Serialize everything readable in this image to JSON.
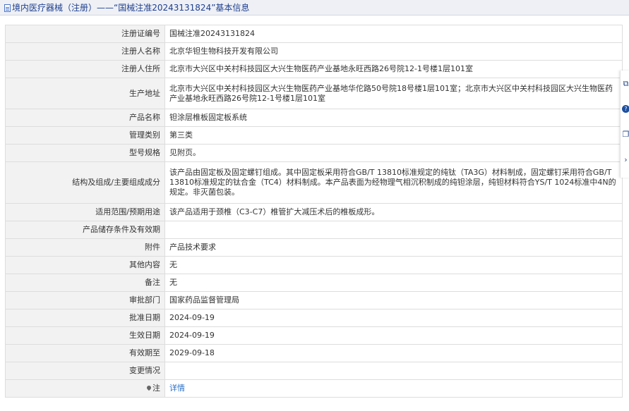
{
  "header": {
    "title": "境内医疗器械（注册）——“国械注准20243131824”基本信息"
  },
  "rows": [
    {
      "label": "注册证编号",
      "value": "国械注准20243131824"
    },
    {
      "label": "注册人名称",
      "value": "北京华钽生物科技开发有限公司"
    },
    {
      "label": "注册人住所",
      "value": "北京市大兴区中关村科技园区大兴生物医药产业基地永旺西路26号院12-1号楼1层101室"
    },
    {
      "label": "生产地址",
      "value": "北京市大兴区中关村科技园区大兴生物医药产业基地华佗路50号院18号楼1层101室；北京市大兴区中关村科技园区大兴生物医药产业基地永旺西路26号院12-1号楼1层101室"
    },
    {
      "label": "产品名称",
      "value": "钽涂层椎板固定板系统"
    },
    {
      "label": "管理类别",
      "value": "第三类"
    },
    {
      "label": "型号规格",
      "value": "见附页。"
    },
    {
      "label": "结构及组成/主要组成成分",
      "value": "该产品由固定板及固定螺钉组成。其中固定板采用符合GB/T 13810标准规定的纯钛（TA3G）材料制成，固定螺钉采用符合GB/T 13810标准规定的钛合金（TC4）材料制成。本产品表面为经物理气相沉积制成的纯钽涂层，纯钽材料符合YS/T 1024标准中4N的规定。非灭菌包装。"
    },
    {
      "label": "适用范围/预期用途",
      "value": "该产品适用于颈椎（C3-C7）椎管扩大减压术后的椎板成形。"
    },
    {
      "label": "产品储存条件及有效期",
      "value": ""
    },
    {
      "label": "附件",
      "value": "产品技术要求"
    },
    {
      "label": "其他内容",
      "value": "无"
    },
    {
      "label": "备注",
      "value": "无"
    },
    {
      "label": "审批部门",
      "value": "国家药品监督管理局"
    },
    {
      "label": "批准日期",
      "value": "2024-09-19"
    },
    {
      "label": "生效日期",
      "value": "2024-09-19"
    },
    {
      "label": "有效期至",
      "value": "2029-09-18"
    },
    {
      "label": "变更情况",
      "value": ""
    },
    {
      "label": "注",
      "value": "详情"
    }
  ],
  "icons": {
    "header": "document-icon",
    "note": "pin-icon",
    "side_tools": [
      "share-icon",
      "help-icon",
      "copy-icon",
      "chevron-right-icon"
    ]
  },
  "colors": {
    "title": "#1e3f8f",
    "link": "#2a6fc7",
    "label_bg": "#f2f2f2"
  }
}
